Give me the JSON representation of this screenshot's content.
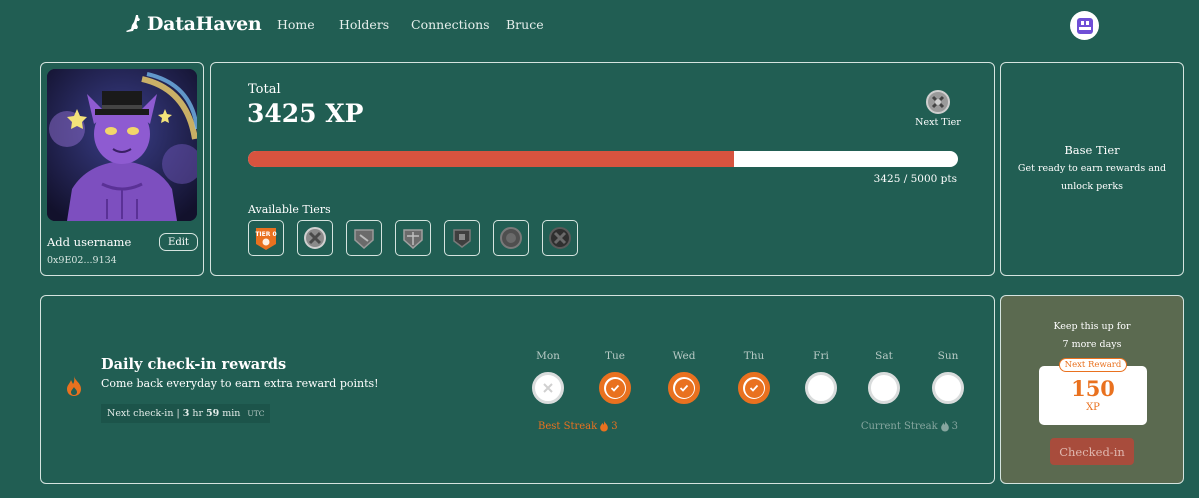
{
  "nav": {
    "brand": "DataHaven",
    "links": [
      "Home",
      "Holders",
      "Connections",
      "Bruce"
    ]
  },
  "profile": {
    "username": "Add username",
    "edit_label": "Edit",
    "address": "0x9E02...9134"
  },
  "xp": {
    "total_label": "Total",
    "value": "3425 XP",
    "next_tier_label": "Next Tier",
    "progress_text": "3425 / 5000 pts",
    "progress_fraction": 0.685,
    "available_tiers_label": "Available Tiers",
    "tiers": [
      {
        "icon": "tier-0-badge-icon",
        "label": "TIER 0",
        "color": "#e9711f"
      },
      {
        "icon": "tier-1-badge-icon",
        "color": "#8a8a8a"
      },
      {
        "icon": "tier-2-badge-icon",
        "color": "#6b6b6b"
      },
      {
        "icon": "tier-3-badge-icon",
        "color": "#6b6b6b"
      },
      {
        "icon": "tier-4-badge-icon",
        "color": "#4a4a4a"
      },
      {
        "icon": "tier-5-badge-icon",
        "color": "#555555"
      },
      {
        "icon": "tier-6-badge-icon",
        "color": "#3a3a3a"
      }
    ]
  },
  "base_tier": {
    "title": "Base Tier",
    "description": "Get ready to earn rewards and unlock perks"
  },
  "checkin": {
    "title": "Daily check-in rewards",
    "subtitle": "Come back everyday to earn extra reward points!",
    "next_label": "Next check-in |",
    "next_hours": "3",
    "next_hours_unit": "hr",
    "next_minutes": "59",
    "next_minutes_unit": "min",
    "timezone": "UTC",
    "days": [
      {
        "label": "Mon",
        "state": "missed"
      },
      {
        "label": "Tue",
        "state": "done"
      },
      {
        "label": "Wed",
        "state": "done"
      },
      {
        "label": "Thu",
        "state": "done"
      },
      {
        "label": "Fri",
        "state": "empty"
      },
      {
        "label": "Sat",
        "state": "empty"
      },
      {
        "label": "Sun",
        "state": "empty"
      }
    ],
    "best_streak_label": "Best Streak",
    "best_streak_value": "3",
    "current_streak_label": "Current Streak",
    "current_streak_value": "3"
  },
  "reward": {
    "keep_line1": "Keep this up for",
    "keep_line2": "7 more days",
    "tag": "Next Reward",
    "amount": "150",
    "unit": "XP",
    "button": "Checked-in"
  },
  "colors": {
    "background": "#215e53",
    "accent": "#e9711f",
    "progress": "#d7533f",
    "reward_panel": "#5b6a50"
  }
}
